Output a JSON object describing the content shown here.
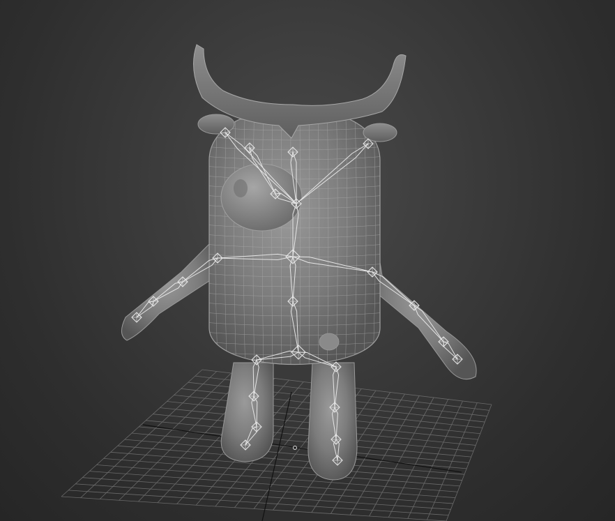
{
  "viewport": {
    "view": "perspective",
    "shading": "wireframe-over-shaded",
    "background_color": "#3a3a3a",
    "grid_color": "#6b6b6b",
    "grid_axis_color": "#111111",
    "mesh_color": "#8c8c8c",
    "wire_color": "#b4b4b4",
    "bone_color": "#e6e6e6"
  },
  "scene": {
    "character": "bull-cartoon-mesh",
    "rig": "biped-skeleton",
    "grid_visible": true
  }
}
